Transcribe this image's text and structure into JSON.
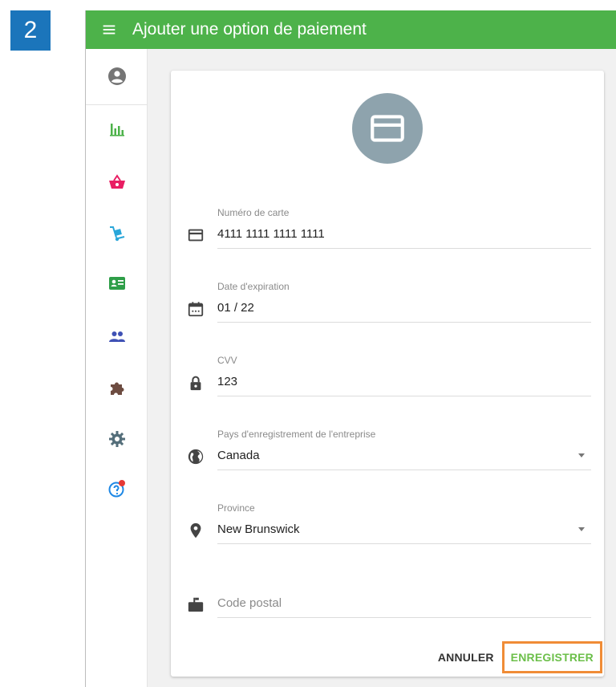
{
  "step": {
    "number": "2"
  },
  "header": {
    "title": "Ajouter une option de paiement",
    "bg_color": "#4db24a"
  },
  "sidebar": {
    "items": [
      {
        "name": "account-circle-icon"
      },
      {
        "name": "bar-chart-icon",
        "color": "#4db24a"
      },
      {
        "name": "basket-icon",
        "color": "#e91e63"
      },
      {
        "name": "hand-truck-icon",
        "color": "#29a6d9"
      },
      {
        "name": "contact-card-icon",
        "color": "#2e9e48"
      },
      {
        "name": "people-icon",
        "color": "#3f51b5"
      },
      {
        "name": "puzzle-icon",
        "color": "#6d4c41"
      },
      {
        "name": "gear-icon",
        "color": "#546e7a"
      },
      {
        "name": "help-icon",
        "color": "#1e88e5"
      }
    ]
  },
  "form": {
    "card_number": {
      "label": "Numéro de carte",
      "value": "4111 1111 1111 1111"
    },
    "expiration": {
      "label": "Date d'expiration",
      "value": "01 / 22"
    },
    "cvv": {
      "label": "CVV",
      "value": "123"
    },
    "country": {
      "label": "Pays d'enregistrement de l'entreprise",
      "value": "Canada"
    },
    "province": {
      "label": "Province",
      "value": "New Brunswick"
    },
    "postal_code": {
      "placeholder": "Code postal",
      "value": ""
    }
  },
  "actions": {
    "cancel_label": "ANNULER",
    "save_label": "ENREGISTRER",
    "highlight_color": "#f08c36"
  }
}
